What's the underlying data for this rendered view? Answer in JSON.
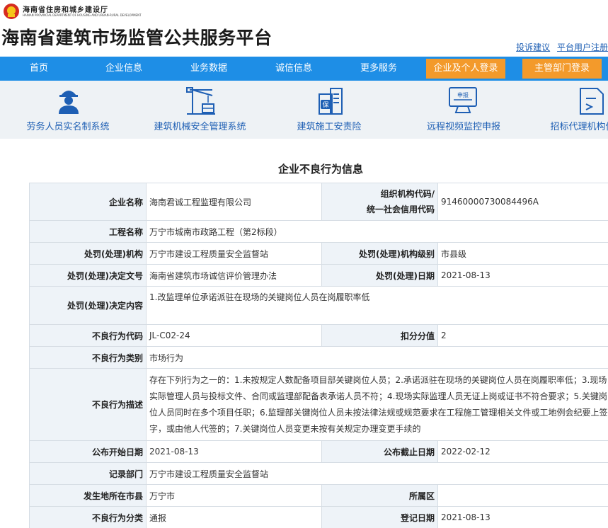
{
  "header": {
    "dept_name": "海南省住房和城乡建设厅",
    "dept_en": "HAINAN PROVINCIAL DEPARTMENT OF HOUSING AND URBAN-RURAL DEVELOPMENT",
    "site_title": "海南省建筑市场监管公共服务平台",
    "links": [
      "投诉建议",
      "平台用户注册"
    ]
  },
  "nav": {
    "items": [
      "首页",
      "企业信息",
      "业务数据",
      "诚信信息",
      "更多服务"
    ],
    "login_enterprise": "企业及个人登录",
    "login_admin": "主管部门登录"
  },
  "systems": [
    {
      "label": "劳务人员实名制系统",
      "icon": "worker-icon"
    },
    {
      "label": "建筑机械安全管理系统",
      "icon": "crane-icon"
    },
    {
      "label": "建筑施工安责险",
      "icon": "insurance-icon",
      "icon_text": "保"
    },
    {
      "label": "远程视频监控申报",
      "icon": "monitor-icon",
      "icon_text": "申报"
    },
    {
      "label": "招标代理机构信",
      "icon": "document-icon"
    }
  ],
  "page_title": "企业不良行为信息",
  "record": {
    "enterprise_name_label": "企业名称",
    "enterprise_name": "海南君诚工程监理有限公司",
    "org_code_label_1": "组织机构代码/",
    "org_code_label_2": "统一社会信用代码",
    "org_code": "91460000730084496A",
    "project_label": "工程名称",
    "project": "万宁市城南市政路工程（第2标段）",
    "penalty_org_label": "处罚(处理)机构",
    "penalty_org": "万宁市建设工程质量安全监督站",
    "penalty_level_label": "处罚(处理)机构级别",
    "penalty_level": "市县级",
    "decision_no_label": "处罚(处理)决定文号",
    "decision_no": "海南省建筑市场诚信评价管理办法",
    "penalty_date_label": "处罚(处理)日期",
    "penalty_date": "2021-08-13",
    "decision_content_label": "处罚(处理)决定内容",
    "decision_content": "1.改监理单位承诺派驻在现场的关键岗位人员在岗履职率低",
    "behavior_code_label": "不良行为代码",
    "behavior_code": "JL-C02-24",
    "deduct_label": "扣分分值",
    "deduct": "2",
    "category_label": "不良行为类别",
    "category": "市场行为",
    "description_label": "不良行为描述",
    "description": "存在下列行为之一的：1.未按规定人数配备项目部关键岗位人员；2.承诺派驻在现场的关键岗位人员在岗履职率低；3.现场实际管理人员与投标文件、合同或监理部配备表承诺人员不符；4.现场实际监理人员无证上岗或证书不符合要求；5.关键岗位人员同时在多个项目任职；6.监理部关键岗位人员未按法律法规或规范要求在工程施工管理相关文件或工地例会纪要上签字，或由他人代签的；7.关键岗位人员变更未按有关规定办理变更手续的",
    "publish_start_label": "公布开始日期",
    "publish_start": "2021-08-13",
    "publish_end_label": "公布截止日期",
    "publish_end": "2022-02-12",
    "record_dept_label": "记录部门",
    "record_dept": "万宁市建设工程质量安全监督站",
    "city_label": "发生地所在市县",
    "city": "万宁市",
    "district_label": "所属区",
    "district": "",
    "behavior_type_label": "不良行为分类",
    "behavior_type": "通报",
    "register_date_label": "登记日期",
    "register_date": "2021-08-13"
  }
}
